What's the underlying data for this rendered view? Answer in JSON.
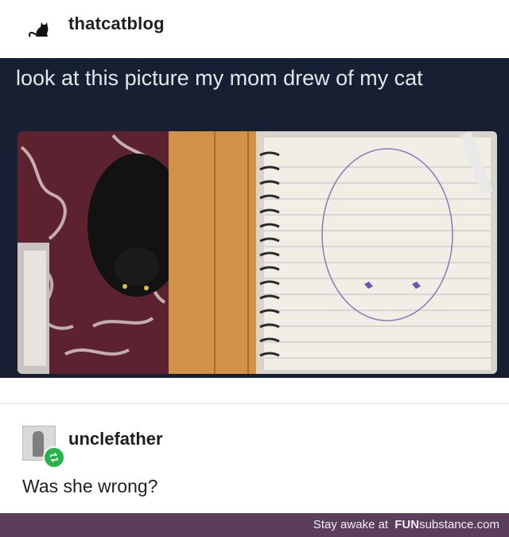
{
  "post": {
    "blog_name": "thatcatblog",
    "text": "look at this picture my mom drew of my cat"
  },
  "reblog": {
    "username": "unclefather",
    "comment": "Was she wrong?"
  },
  "footer": {
    "prefix": "Stay awake at",
    "brand_bold": "FUN",
    "brand_rest": "substance",
    "brand_tld": ".com"
  },
  "icons": {
    "blog_avatar": "black-cat-silhouette-icon",
    "reblog_badge": "reblog-icon"
  },
  "colors": {
    "post_background": "#172032",
    "post_text": "#e4e6ea",
    "reblog_badge": "#27b44a",
    "footer_background": "#5a3e5c"
  }
}
